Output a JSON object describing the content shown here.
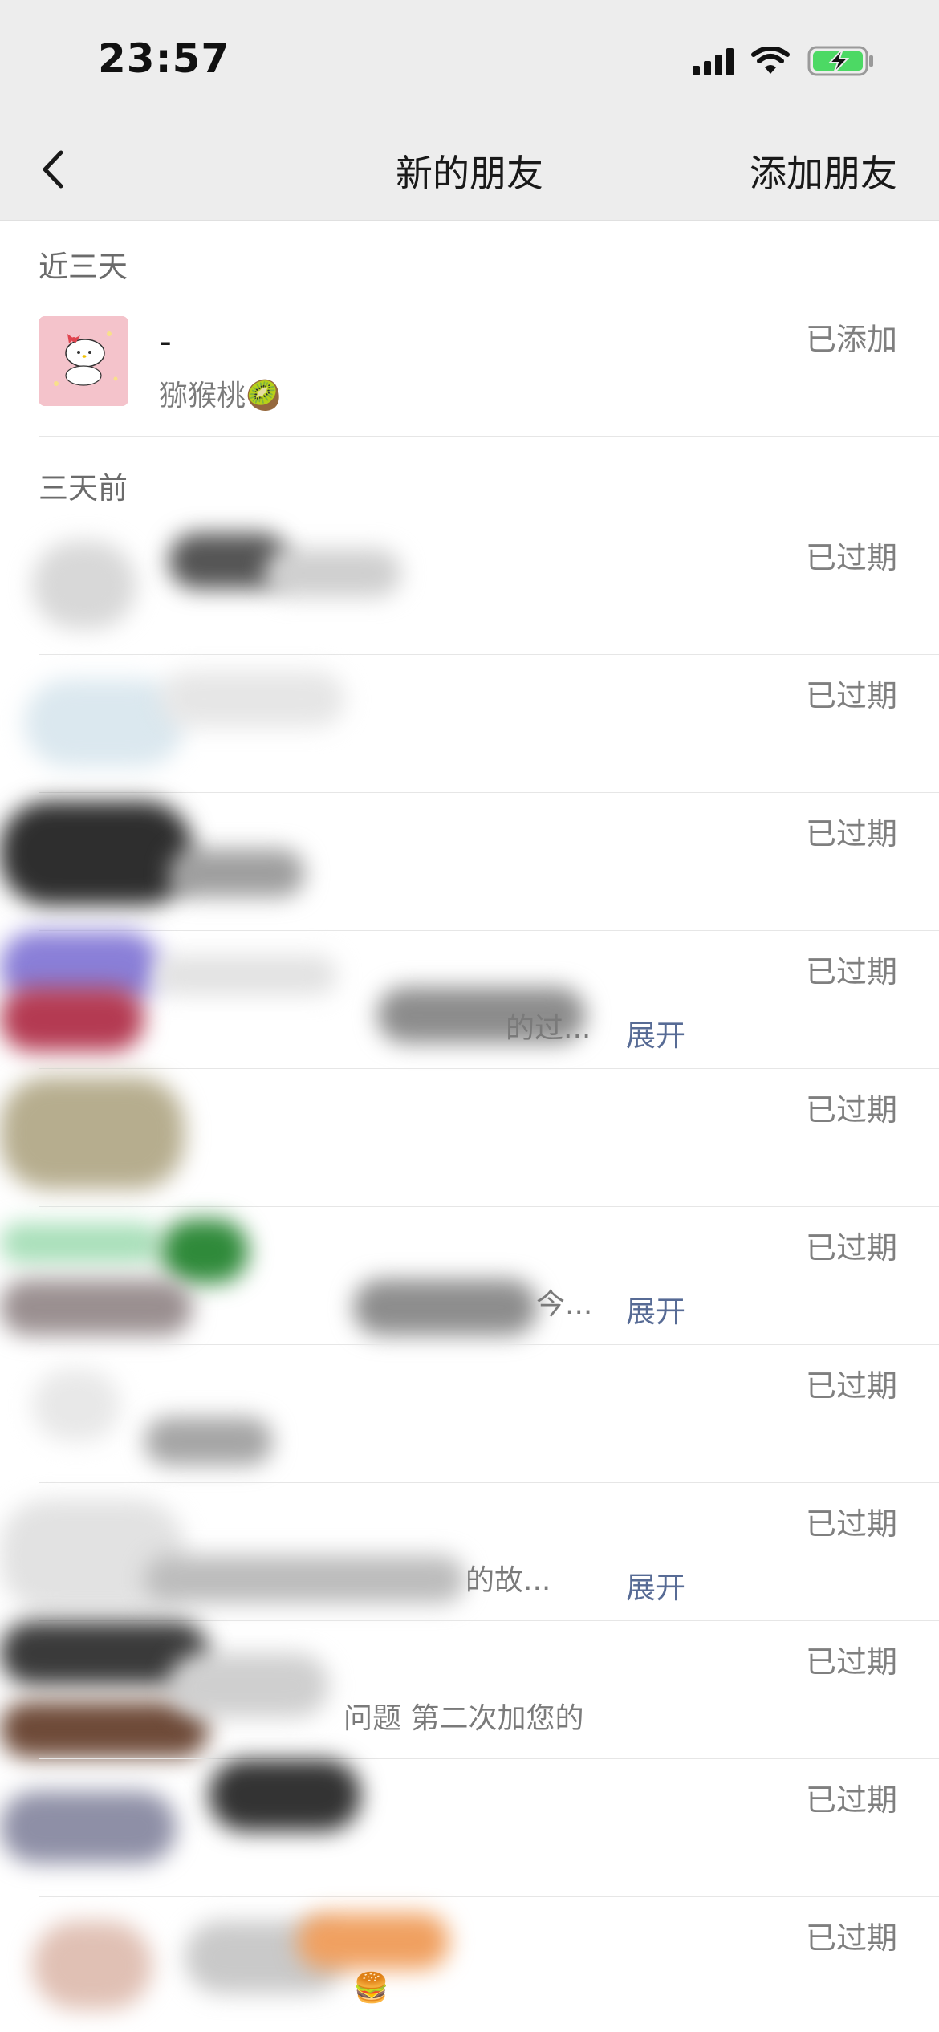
{
  "status_bar": {
    "time": "23:57",
    "icons": [
      "cellular-signal-icon",
      "wifi-icon",
      "battery-charging-icon"
    ],
    "battery_color": "#4cd964"
  },
  "nav": {
    "back_icon": "chevron-left-icon",
    "title": "新的朋友",
    "right_action": "添加朋友"
  },
  "sections": [
    {
      "label": "近三天"
    },
    {
      "label": "三天前"
    }
  ],
  "recent": [
    {
      "name": "-",
      "message": "猕猴桃🥝",
      "status": "已添加",
      "expand": ""
    }
  ],
  "older": [
    {
      "name": "",
      "message": "",
      "status": "已过期",
      "expand": ""
    },
    {
      "name": "",
      "message": "",
      "status": "已过期",
      "expand": ""
    },
    {
      "name": "",
      "message": "",
      "status": "已过期",
      "expand": ""
    },
    {
      "name": "",
      "message": "的过...",
      "status": "已过期",
      "expand": "展开"
    },
    {
      "name": "",
      "message": "",
      "status": "已过期",
      "expand": ""
    },
    {
      "name": "",
      "message": "今...",
      "status": "已过期",
      "expand": "展开"
    },
    {
      "name": "",
      "message": "",
      "status": "已过期",
      "expand": ""
    },
    {
      "name": "",
      "message": "的故...",
      "status": "已过期",
      "expand": "展开"
    },
    {
      "name": "",
      "message": "问题 第二次加您的",
      "status": "已过期",
      "expand": ""
    },
    {
      "name": "",
      "message": "",
      "status": "已过期",
      "expand": ""
    },
    {
      "name": "",
      "message": "🍔",
      "status": "已过期",
      "expand": ""
    }
  ],
  "colors": {
    "header_bg": "#ededed",
    "link_blue": "#576b95",
    "muted_text": "#7f7f7f"
  }
}
